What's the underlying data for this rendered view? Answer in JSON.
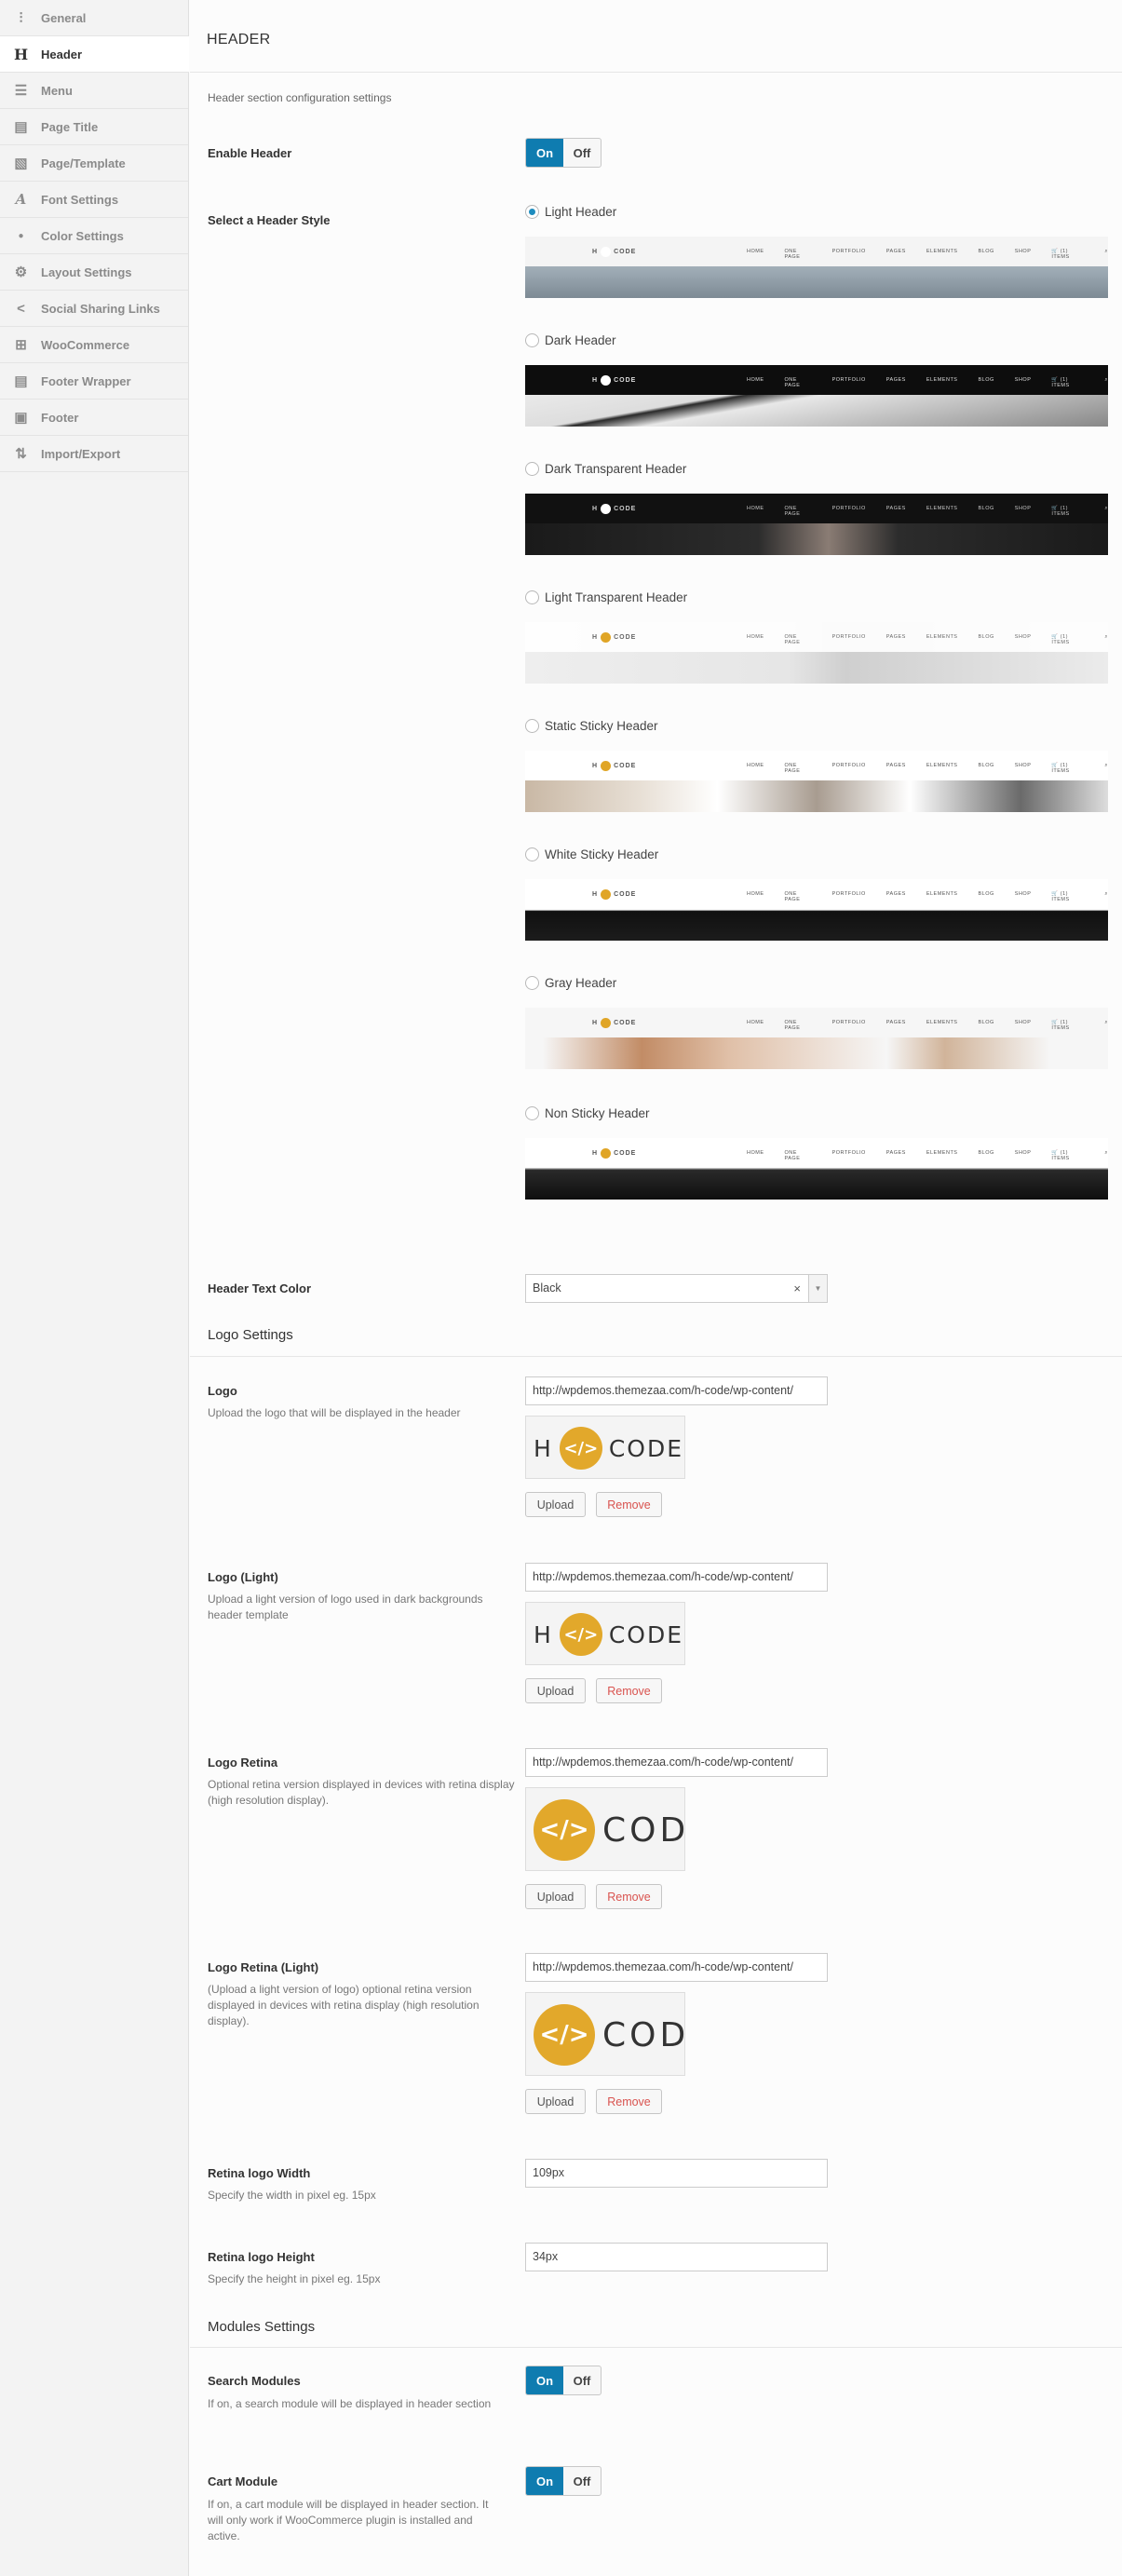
{
  "sidebar": {
    "items": [
      {
        "label": "General",
        "icon": "sliders-icon",
        "glyph": "⫶"
      },
      {
        "label": "Header",
        "icon": "header-h-icon",
        "glyph": "H"
      },
      {
        "label": "Menu",
        "icon": "hamburger-menu-icon",
        "glyph": "☰"
      },
      {
        "label": "Page Title",
        "icon": "page-title-icon",
        "glyph": "▤"
      },
      {
        "label": "Page/Template",
        "icon": "page-template-icon",
        "glyph": "▧"
      },
      {
        "label": "Font Settings",
        "icon": "font-a-icon",
        "glyph": "A"
      },
      {
        "label": "Color Settings",
        "icon": "color-drop-icon",
        "glyph": "●"
      },
      {
        "label": "Layout Settings",
        "icon": "layout-gears-icon",
        "glyph": "⚙"
      },
      {
        "label": "Social Sharing Links",
        "icon": "share-icon",
        "glyph": "<"
      },
      {
        "label": "WooCommerce",
        "icon": "cart-icon",
        "glyph": "⊞"
      },
      {
        "label": "Footer Wrapper",
        "icon": "footer-wrapper-icon",
        "glyph": "▤"
      },
      {
        "label": "Footer",
        "icon": "footer-icon",
        "glyph": "▣"
      },
      {
        "label": "Import/Export",
        "icon": "import-export-icon",
        "glyph": "⇅"
      }
    ],
    "active": 1
  },
  "header": {
    "title": "HEADER",
    "description": "Header section configuration settings"
  },
  "enable_header": {
    "label": "Enable Header",
    "on": "On",
    "off": "Off",
    "value": "On"
  },
  "header_style": {
    "label": "Select a Header Style",
    "selected": "Light Header",
    "options": [
      {
        "label": "Light Header",
        "theme": "light"
      },
      {
        "label": "Dark Header",
        "theme": "dark"
      },
      {
        "label": "Dark Transparent Header",
        "theme": "darktrans"
      },
      {
        "label": "Light Transparent Header",
        "theme": "lighttrans"
      },
      {
        "label": "Static Sticky Header",
        "theme": "static"
      },
      {
        "label": "White Sticky Header",
        "theme": "white"
      },
      {
        "label": "Gray Header",
        "theme": "gray"
      },
      {
        "label": "Non Sticky Header",
        "theme": "nonsticky"
      }
    ]
  },
  "preview": {
    "logo_left": "H",
    "logo_right": "CODE",
    "menu": [
      "HOME",
      "ONE PAGE",
      "PORTFOLIO",
      "PAGES",
      "ELEMENTS",
      "BLOG",
      "SHOP"
    ],
    "cart": "(1) ITEMS"
  },
  "header_text_color": {
    "label": "Header Text Color",
    "value": "Black",
    "clear": "×",
    "arrow": "▼"
  },
  "logo_settings": {
    "title": "Logo Settings",
    "upload": "Upload",
    "remove": "Remove",
    "items": [
      {
        "label": "Logo",
        "desc": "Upload the logo that will be displayed in the header",
        "url": "http://wpdemos.themezaa.com/h-code/wp-content/",
        "logo_left": "H",
        "logo_right": "CODE"
      },
      {
        "label": "Logo (Light)",
        "desc": "Upload a light version of logo used in dark backgrounds header template",
        "url": "http://wpdemos.themezaa.com/h-code/wp-content/",
        "logo_left": "H",
        "logo_right": "CODE"
      },
      {
        "label": "Logo Retina",
        "desc": "Optional retina version displayed in devices with retina display (high resolution display).",
        "url": "http://wpdemos.themezaa.com/h-code/wp-content/",
        "logo_right": "COD"
      },
      {
        "label": "Logo Retina (Light)",
        "desc": "(Upload a light version of logo) optional retina version displayed in devices with retina display (high resolution display).",
        "url": "http://wpdemos.themezaa.com/h-code/wp-content/",
        "logo_right": "COD"
      }
    ]
  },
  "retina_width": {
    "label": "Retina logo Width",
    "desc": "Specify the width in pixel eg. 15px",
    "value": "109px"
  },
  "retina_height": {
    "label": "Retina logo Height",
    "desc": "Specify the height in pixel eg. 15px",
    "value": "34px"
  },
  "modules": {
    "title": "Modules Settings",
    "search": {
      "label": "Search Modules",
      "desc": "If on, a search module will be displayed in header section",
      "on": "On",
      "off": "Off",
      "value": "On"
    },
    "cart": {
      "label": "Cart Module",
      "desc": "If on, a cart module will be displayed in header section. It will only work if WooCommerce plugin is installed and active.",
      "on": "On",
      "off": "Off",
      "value": "On"
    }
  },
  "colors": {
    "accent": "#0f7cb0",
    "logo_circle": "#e2a82b",
    "remove": "#d9534f"
  }
}
